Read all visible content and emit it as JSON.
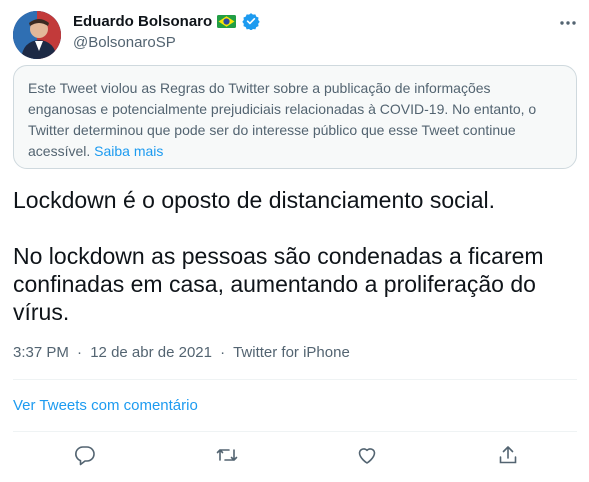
{
  "author": {
    "display_name": "Eduardo Bolsonaro",
    "handle": "@BolsonaroSP",
    "flag_icon": "brazil-flag-icon",
    "verified_icon": "verified-badge-icon",
    "verified_color": "#1d9bf0"
  },
  "notice": {
    "text": "Este Tweet violou as Regras do Twitter sobre a publicação de informações enganosas e potencialmente prejudiciais relacionadas à COVID-19. No entanto, o Twitter determinou que pode ser do interesse público que esse Tweet continue acessível.",
    "link_label": "Saiba mais"
  },
  "tweet": {
    "paragraph_1": "Lockdown é o oposto de distanciamento social.",
    "paragraph_2": "No lockdown as pessoas são condenadas a ficarem confinadas em casa, aumentando a proliferação do vírus."
  },
  "meta": {
    "time": "3:37 PM",
    "separator": "·",
    "date": "12 de abr de 2021",
    "source": "Twitter for iPhone"
  },
  "quote_link": "Ver Tweets com comentário",
  "actions": [
    {
      "icon": "reply-icon"
    },
    {
      "icon": "retweet-icon"
    },
    {
      "icon": "like-icon"
    },
    {
      "icon": "share-icon"
    }
  ],
  "colors": {
    "accent": "#1d9bf0",
    "secondary_text": "#536471",
    "notice_background": "#f7f9f9",
    "border": "#cfd9de"
  }
}
